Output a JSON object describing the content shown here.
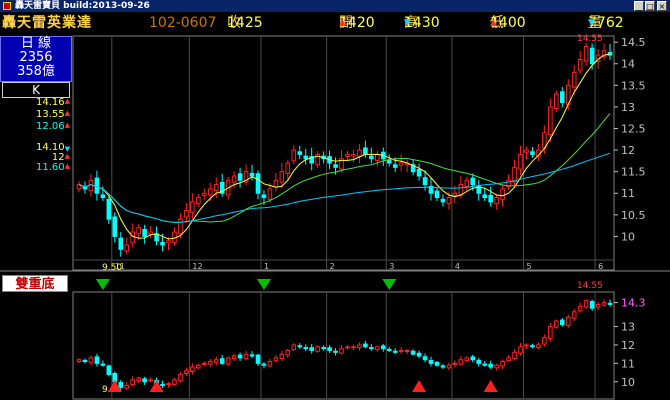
{
  "window": {
    "title": "轟天雷寶貝 build:2013-09-26",
    "buttons": [
      "_",
      "□",
      "×"
    ]
  },
  "quote": {
    "name": "轟天雷英業達",
    "code_date": "102-0607",
    "close_label": "收",
    "close": "1425",
    "open_label": "開",
    "open": "1420",
    "high_label": "高",
    "high": "1430",
    "low_label": "低",
    "low": "1400",
    "vol_label": "量",
    "vol": "7762"
  },
  "left_panel": {
    "period": "日  線",
    "val1": "2356",
    "val2": "358億",
    "k_label": "K",
    "ma_group1": [
      {
        "value": "14.16",
        "dir": "up",
        "color": "#ffff40"
      },
      {
        "value": "13.55",
        "dir": "up",
        "color": "#ffff40"
      },
      {
        "value": "12.06",
        "dir": "up",
        "color": "#00ffff"
      }
    ],
    "ma_group2": [
      {
        "value": "14.10",
        "dir": "dn",
        "color": "#ffff40"
      },
      {
        "value": "12",
        "dir": "up",
        "color": "#ffff40"
      },
      {
        "value": "11.60",
        "dir": "up",
        "color": "#00ffff"
      }
    ],
    "pattern": "雙重底"
  },
  "colors": {
    "up": "#ff2020",
    "down": "#00ffff",
    "grid": "#4b4b4b",
    "axis": "#c0c0c0",
    "ma_short": "#ffff40",
    "ma_mid": "#40e040",
    "ma_long": "#00c8ff"
  },
  "chart_data": [
    {
      "type": "candlestick",
      "title": "",
      "ylim": [
        9.5,
        14.55
      ],
      "yticks": [
        "14.5",
        "14",
        "13.5",
        "13",
        "12.5",
        "12",
        "11.5",
        "11",
        "10.5",
        "10"
      ],
      "xticks": [
        "11",
        "12",
        "1",
        "2",
        "3",
        "4",
        "5",
        "6"
      ],
      "annotations": {
        "high": "14.55",
        "low": "9.50"
      },
      "close": [
        11.2,
        11.1,
        11.3,
        11.0,
        10.9,
        10.4,
        10.0,
        9.7,
        9.8,
        10.1,
        10.2,
        10.0,
        10.1,
        9.9,
        9.8,
        9.9,
        10.1,
        10.4,
        10.6,
        10.8,
        10.9,
        11.0,
        11.1,
        11.2,
        11.0,
        11.3,
        11.4,
        11.3,
        11.5,
        11.4,
        11.0,
        10.9,
        11.1,
        11.3,
        11.5,
        11.7,
        12.0,
        11.9,
        11.8,
        11.7,
        11.9,
        11.8,
        11.7,
        11.6,
        11.8,
        11.9,
        11.9,
        12.0,
        11.9,
        11.8,
        11.9,
        11.8,
        11.7,
        11.6,
        11.7,
        11.7,
        11.5,
        11.4,
        11.2,
        11.0,
        10.9,
        10.8,
        10.9,
        11.0,
        11.2,
        11.3,
        11.2,
        11.0,
        10.9,
        10.8,
        10.9,
        11.1,
        11.3,
        11.6,
        11.9,
        12.0,
        11.9,
        12.0,
        12.4,
        13.0,
        13.3,
        13.1,
        13.5,
        13.8,
        14.1,
        14.4,
        14.0,
        14.2,
        14.3,
        14.2
      ],
      "moving_averages": [
        "14.16",
        "13.55",
        "12.06"
      ],
      "events": [
        {
          "label": "down",
          "index": 4
        },
        {
          "label": "down",
          "index": 31
        },
        {
          "label": "down",
          "index": 52
        }
      ]
    },
    {
      "type": "candlestick",
      "title": "",
      "ylim": [
        9.5,
        14.55
      ],
      "yticks": [
        "14.3",
        "13",
        "12",
        "11",
        "10"
      ],
      "annotations": {
        "high": "14.55",
        "low": "9.6"
      },
      "events": [
        {
          "label": "up",
          "index": 6
        },
        {
          "label": "up",
          "index": 13
        },
        {
          "label": "up",
          "index": 57
        },
        {
          "label": "up",
          "index": 69
        }
      ]
    }
  ]
}
